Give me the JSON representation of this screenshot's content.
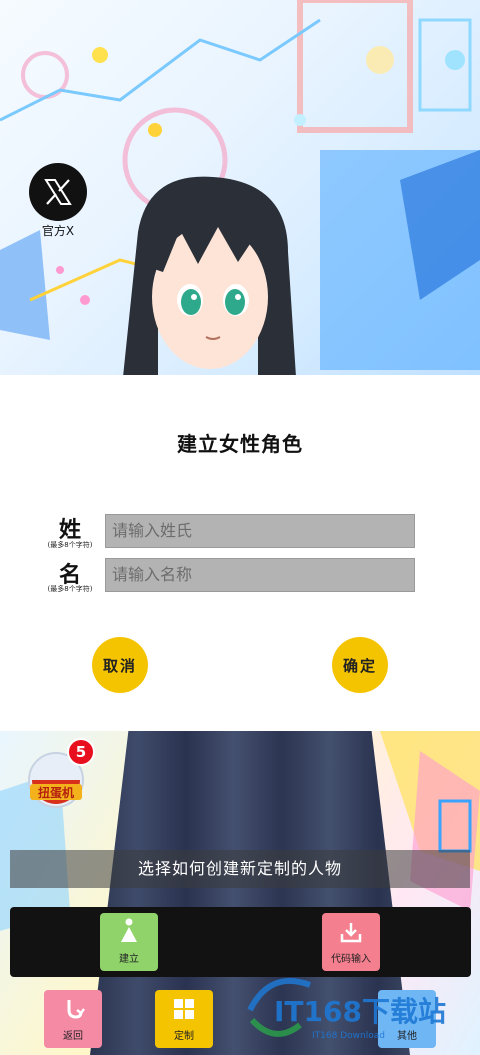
{
  "official_x": {
    "label": "官方X"
  },
  "form": {
    "title": "建立女性角色",
    "surname": {
      "label": "姓",
      "hint": "(最多8个字符)",
      "placeholder": "请输入姓氏"
    },
    "given_name": {
      "label": "名",
      "hint": "(最多8个字符)",
      "placeholder": "请输入名称"
    },
    "cancel_label": "取消",
    "confirm_label": "确定"
  },
  "gacha": {
    "label": "扭蛋机",
    "badge_count": "5"
  },
  "prompt": "选择如何创建新定制的人物",
  "tray": {
    "create_label": "建立",
    "code_input_label": "代码输入"
  },
  "nav": {
    "back_label": "返回",
    "custom_label": "定制",
    "other_label": "其他"
  },
  "watermark": {
    "brand": "IT168下载站",
    "subtitle": "IT168 Download"
  },
  "colors": {
    "button_yellow": "#f5c400",
    "create_green": "#8fd36a",
    "code_pink": "#f47f8f",
    "back_pink": "#f58aa5",
    "badge_red": "#e8101e"
  }
}
